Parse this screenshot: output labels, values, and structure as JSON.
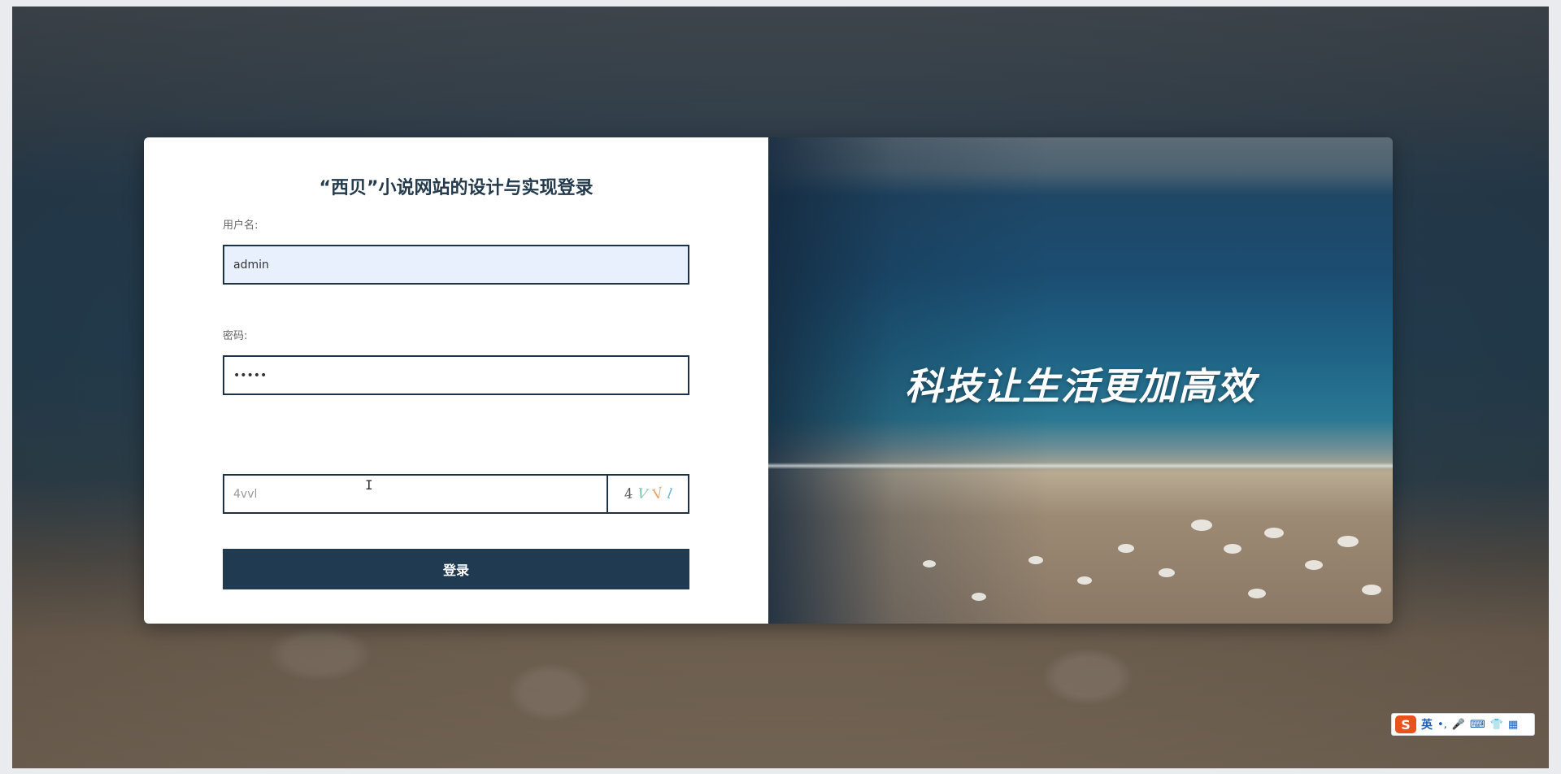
{
  "login": {
    "title": "“西贝”小说网站的设计与实现登录",
    "username_label": "用户名:",
    "username_value": "admin",
    "password_label": "密码:",
    "password_value": "12345",
    "captcha_value": "4vvl",
    "captcha_image_chars": [
      "4",
      "V",
      "V",
      "l"
    ],
    "login_button": "登录"
  },
  "banner": {
    "slogan": "科技让生活更加高效"
  },
  "ime": {
    "logo": "S",
    "mode": "英",
    "punct": "•,",
    "icons": [
      "microphone-icon",
      "keyboard-icon",
      "skin-icon",
      "toolbox-icon"
    ]
  }
}
